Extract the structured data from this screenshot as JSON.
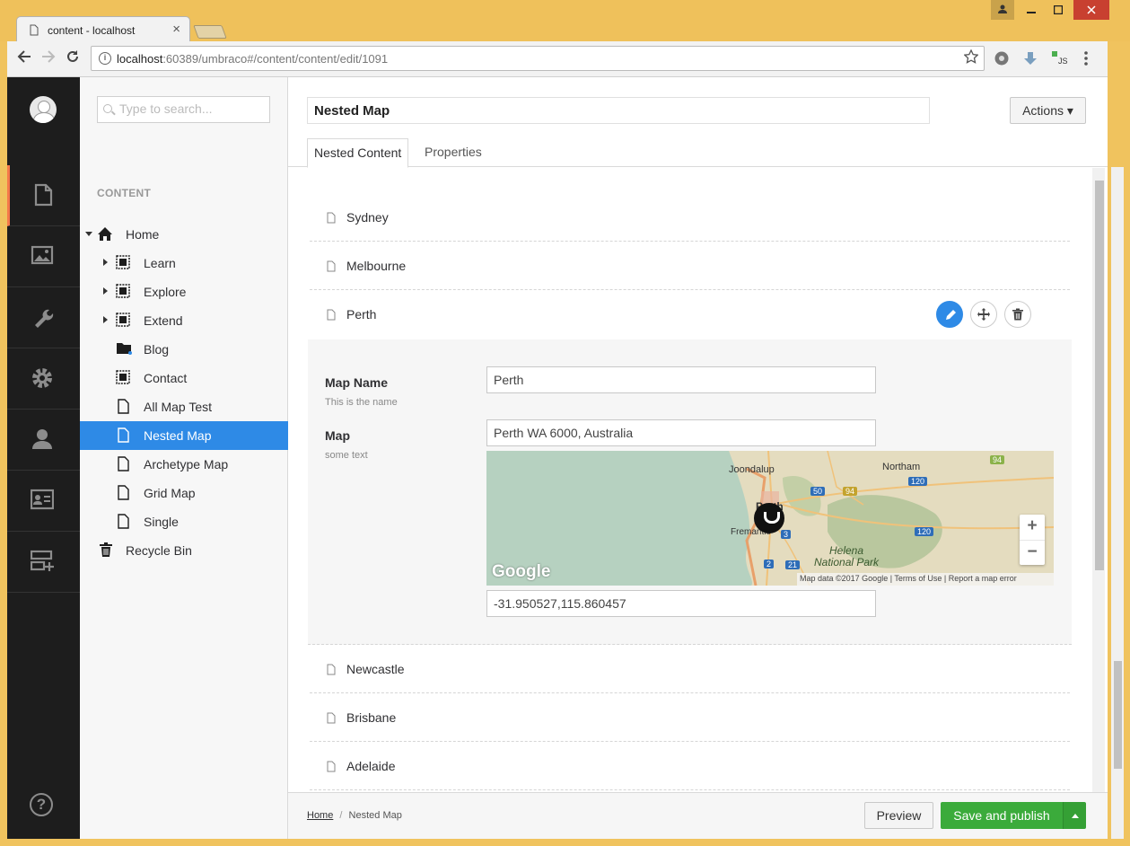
{
  "browser": {
    "tab_title": "content - localhost",
    "tab_close": "×",
    "url_host": "localhost",
    "url_rest": ":60389/umbraco#/content/content/edit/1091",
    "info": "i"
  },
  "tree": {
    "search_placeholder": "Type to search...",
    "heading": "CONTENT",
    "nodes": [
      {
        "label": "Home"
      },
      {
        "label": "Learn"
      },
      {
        "label": "Explore"
      },
      {
        "label": "Extend"
      },
      {
        "label": "Blog"
      },
      {
        "label": "Contact"
      },
      {
        "label": "All Map Test"
      },
      {
        "label": "Nested Map"
      },
      {
        "label": "Archetype Map"
      },
      {
        "label": "Grid Map"
      },
      {
        "label": "Single"
      },
      {
        "label": "Recycle Bin"
      }
    ]
  },
  "header": {
    "name": "Nested Map",
    "actions_label": "Actions ▾",
    "tabs": [
      {
        "label": "Nested Content"
      },
      {
        "label": "Properties"
      }
    ]
  },
  "nested": {
    "items": [
      {
        "title": "Sydney"
      },
      {
        "title": "Melbourne"
      },
      {
        "title": "Perth"
      },
      {
        "title": "Newcastle"
      },
      {
        "title": "Brisbane"
      },
      {
        "title": "Adelaide"
      }
    ],
    "editor": {
      "map_name_label": "Map Name",
      "map_name_desc": "This is the name",
      "map_name_value": "Perth",
      "map_label": "Map",
      "map_desc": "some text",
      "map_address": "Perth WA 6000, Australia",
      "coordinates": "-31.950527,115.860457"
    }
  },
  "map": {
    "labels": {
      "joondalup": "Joondalup",
      "northam": "Northam",
      "perth": "Perth",
      "fremantle": "Fremantle",
      "helena": "Helena\nNational Park",
      "r50": "50",
      "r94a": "94",
      "r94b": "94",
      "r120a": "120",
      "r120b": "120",
      "r2": "2",
      "r21": "21",
      "r3": "3"
    },
    "google": "Google",
    "zoom_in": "+",
    "zoom_out": "−",
    "attribution": "Map data ©2017 Google   |   Terms of Use   |   Report a map error"
  },
  "footer": {
    "crumb_home": "Home",
    "crumb_sep": "/",
    "crumb_current": "Nested Map",
    "preview_label": "Preview",
    "save_label": "Save and publish"
  },
  "help": "?"
}
